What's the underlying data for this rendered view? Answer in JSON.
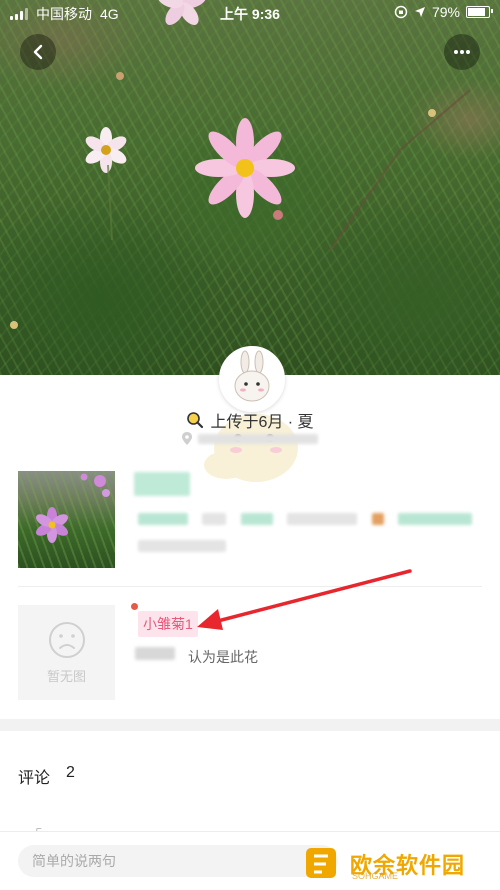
{
  "status_bar": {
    "carrier": "中国移动",
    "network": "4G",
    "time": "上午 9:36",
    "battery": "79%"
  },
  "header": {
    "back_icon": "chevron-left-icon",
    "more_icon": "more-dots-icon"
  },
  "uploader": {
    "upload_info": "上传于6月 · 夏"
  },
  "identification": {
    "no_image_label": "暂无图",
    "tag": "小雏菊1",
    "thinks_text": "认为是此花"
  },
  "comments": {
    "title": "评论",
    "count": "2"
  },
  "comment_bar": {
    "placeholder": "简单的说两句"
  },
  "watermark": {
    "text": "欧余软件园",
    "sub": "SOHGAME"
  },
  "colors": {
    "tag_text": "#e75a7c",
    "tag_bg": "#fde4ec",
    "section_band": "#f2f2f2",
    "watermark": "#f0a800"
  }
}
